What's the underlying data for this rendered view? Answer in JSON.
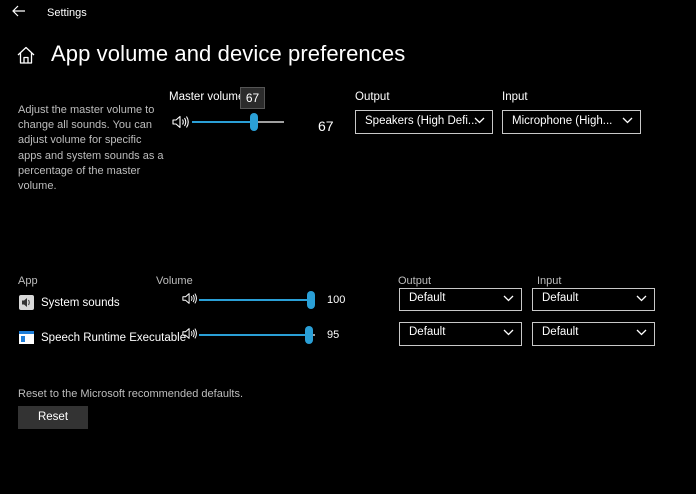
{
  "titlebar": {
    "title": "Settings"
  },
  "page": {
    "title": "App volume and device preferences"
  },
  "description": "Adjust the master volume to change all sounds. You can adjust volume for specific apps and system sounds as a percentage of the master volume.",
  "master": {
    "label": "Master volume",
    "tooltip": "67",
    "value": "67",
    "level_percent": 67,
    "output_label": "Output",
    "output_value": "Speakers (High Defi...",
    "input_label": "Input",
    "input_value": "Microphone (High..."
  },
  "apps_header": {
    "app": "App",
    "volume": "Volume",
    "output": "Output",
    "input": "Input"
  },
  "apps": [
    {
      "name": "System sounds",
      "value": "100",
      "level_percent": 100,
      "output": "Default",
      "input": "Default"
    },
    {
      "name": "Speech Runtime Executable",
      "value": "95",
      "level_percent": 95,
      "output": "Default",
      "input": "Default"
    }
  ],
  "reset": {
    "text": "Reset to the Microsoft recommended defaults.",
    "button": "Reset"
  },
  "colors": {
    "accent": "#2a9fd6",
    "background": "#000000"
  },
  "icons": [
    "back-arrow-icon",
    "home-icon",
    "speaker-icon",
    "chevron-down-icon",
    "system-sounds-icon",
    "speech-app-icon"
  ]
}
